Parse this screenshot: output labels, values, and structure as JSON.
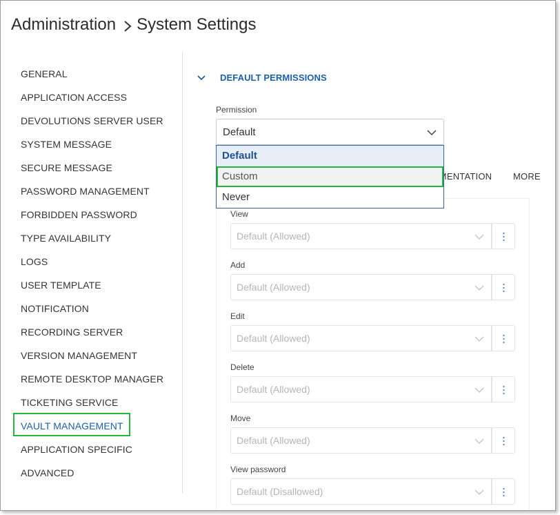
{
  "breadcrumb": {
    "root": "Administration",
    "current": "System Settings"
  },
  "sidebar": {
    "items": [
      {
        "label": "GENERAL"
      },
      {
        "label": "APPLICATION ACCESS"
      },
      {
        "label": "DEVOLUTIONS SERVER USER"
      },
      {
        "label": "SYSTEM MESSAGE"
      },
      {
        "label": "SECURE MESSAGE"
      },
      {
        "label": "PASSWORD MANAGEMENT"
      },
      {
        "label": "FORBIDDEN PASSWORD"
      },
      {
        "label": "TYPE AVAILABILITY"
      },
      {
        "label": "LOGS"
      },
      {
        "label": "USER TEMPLATE"
      },
      {
        "label": "NOTIFICATION"
      },
      {
        "label": "RECORDING SERVER"
      },
      {
        "label": "VERSION MANAGEMENT"
      },
      {
        "label": "REMOTE DESKTOP MANAGER"
      },
      {
        "label": "TICKETING SERVICE"
      },
      {
        "label": "VAULT MANAGEMENT"
      },
      {
        "label": "APPLICATION SPECIFIC"
      },
      {
        "label": "ADVANCED"
      }
    ],
    "active_label": "VAULT MANAGEMENT"
  },
  "section": {
    "title": "DEFAULT PERMISSIONS"
  },
  "permission": {
    "label": "Permission",
    "value": "Default",
    "options": [
      "Default",
      "Custom",
      "Never"
    ],
    "selected_option": "Default",
    "highlighted_option": "Custom"
  },
  "tabs_peek": {
    "partial_tab": "IMENTATION",
    "more_tab": "MORE"
  },
  "fields": [
    {
      "label": "View",
      "value": "Default (Allowed)"
    },
    {
      "label": "Add",
      "value": "Default (Allowed)"
    },
    {
      "label": "Edit",
      "value": "Default (Allowed)"
    },
    {
      "label": "Delete",
      "value": "Default (Allowed)"
    },
    {
      "label": "Move",
      "value": "Default (Allowed)"
    },
    {
      "label": "View password",
      "value": "Default (Disallowed)"
    }
  ],
  "colors": {
    "accent": "#1d5fa8",
    "highlight_outline": "#1fb83a",
    "disabled_text": "#b5b5b5"
  }
}
